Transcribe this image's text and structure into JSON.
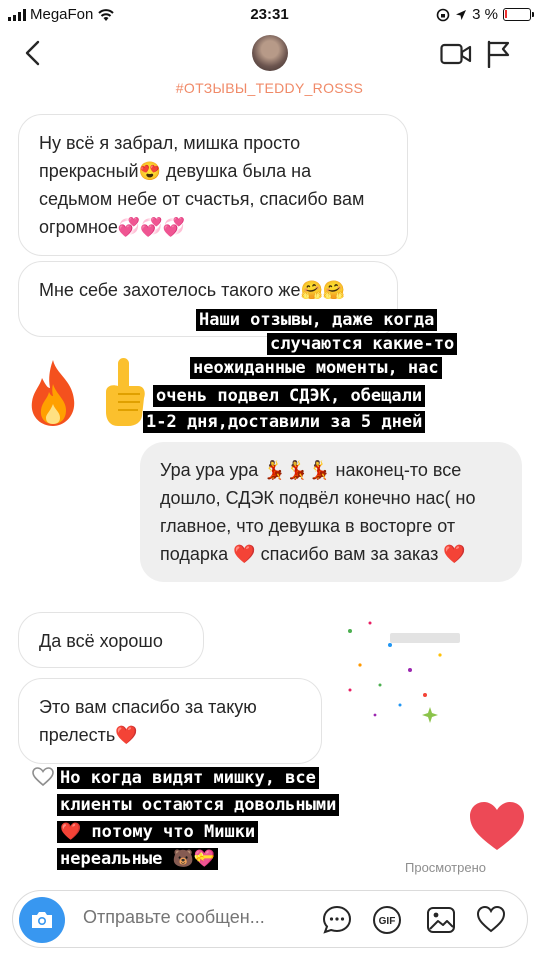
{
  "status_bar": {
    "carrier": "MegaFon",
    "time": "23:31",
    "battery": "3 %"
  },
  "header": {
    "title": "#ОТЗЫВЫ_TEDDY_ROSSS"
  },
  "messages": [
    {
      "id": "m1",
      "direction": "in",
      "text": "Ну всё я забрал, мишка просто прекрасный😍 девушка была на седьмом небе от счастья, спасибо вам огромное💞💞💞"
    },
    {
      "id": "m2",
      "direction": "in",
      "text": "Мне себе захотелось такого же🤗🤗"
    },
    {
      "id": "m3",
      "direction": "in",
      "text": "🔥☝️"
    },
    {
      "id": "m4",
      "direction": "out",
      "text": "Ура ура ура 💃💃💃 наконец-то все дошло, СДЭК подвёл конечно нас( но главное, что девушка в восторге от подарка ❤️ спасибо вам за заказ ❤️"
    },
    {
      "id": "m5",
      "direction": "in",
      "text": "Да всё хорошо"
    },
    {
      "id": "m6",
      "direction": "in",
      "text": "Это вам спасибо за такую прелесть❤️"
    }
  ],
  "overlay_1": [
    "Наши отзывы, даже когда",
    "случаются какие-то",
    "неожиданные моменты, нас",
    "очень подвел СДЭК, обещали",
    "1-2 дня,доставили за 5 дней"
  ],
  "overlay_2": [
    "Но когда видят мишку, все",
    "клиенты остаются довольными",
    "❤️ потому что Мишки",
    "нереальные 🐻💝"
  ],
  "seen_label": "Просмотрено",
  "composer": {
    "placeholder": "Отправьте сообщен..."
  },
  "colors": {
    "accent_blue": "#3897f0",
    "title_orange": "#f08a68",
    "heart_red": "#ed4956"
  }
}
